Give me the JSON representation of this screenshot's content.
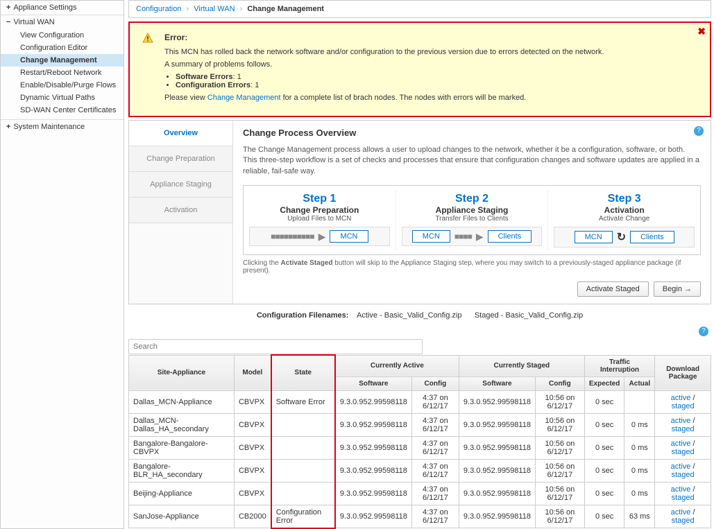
{
  "sidebar": {
    "sections": [
      {
        "label": "Appliance Settings",
        "expanded": false
      },
      {
        "label": "Virtual WAN",
        "expanded": true,
        "items": [
          "View Configuration",
          "Configuration Editor",
          "Change Management",
          "Restart/Reboot Network",
          "Enable/Disable/Purge Flows",
          "Dynamic Virtual Paths",
          "SD-WAN Center Certificates"
        ],
        "active_index": 2
      },
      {
        "label": "System Maintenance",
        "expanded": false
      }
    ]
  },
  "breadcrumb": {
    "crumb1": "Configuration",
    "crumb2": "Virtual WAN",
    "crumb3": "Change Management"
  },
  "error": {
    "heading": "Error:",
    "line1": "This MCN has rolled back the network software and/or configuration to the previous version due to errors detected on the network.",
    "line2": "A summary of problems follows.",
    "bullets": {
      "sw_label": "Software Errors",
      "sw_count": ": 1",
      "cfg_label": "Configuration Errors",
      "cfg_count": ": 1"
    },
    "footer_pre": "Please view ",
    "footer_link": "Change Management",
    "footer_post": " for a complete list of brach nodes. The nodes with errors will be marked."
  },
  "tabs": {
    "overview": "Overview",
    "prep": "Change Preparation",
    "staging": "Appliance Staging",
    "activation": "Activation"
  },
  "main": {
    "title": "Change Process Overview",
    "desc": "The Change Management process allows a user to upload changes to the network, whether it be a configuration, software, or both. This three-step workflow is a set of checks and processes that ensure that configuration changes and software updates are applied in a reliable, fail-safe way.",
    "steps": [
      {
        "num": "Step 1",
        "title": "Change Preparation",
        "sub": "Upload Files to MCN",
        "chips": [
          "MCN"
        ],
        "flow_style": "dots"
      },
      {
        "num": "Step 2",
        "title": "Appliance Staging",
        "sub": "Transfer Files to Clients",
        "chips": [
          "MCN",
          "Clients"
        ],
        "flow_style": "dots"
      },
      {
        "num": "Step 3",
        "title": "Activation",
        "sub": "Activate Change",
        "chips": [
          "MCN",
          "Clients"
        ],
        "flow_style": "refresh"
      }
    ],
    "note_pre": "Clicking the ",
    "note_bold": "Activate Staged",
    "note_post": " button will skip to the Appliance Staging step, where you may switch to a previously-staged appliance package (if present).",
    "btn_activate": "Activate Staged",
    "btn_begin": "Begin →"
  },
  "config_fn": {
    "label": "Configuration Filenames:",
    "active_label": "Active - ",
    "active_val": "Basic_Valid_Config.zip",
    "staged_label": "Staged - ",
    "staged_val": "Basic_Valid_Config.zip"
  },
  "search_placeholder": "Search",
  "table": {
    "headers": {
      "site": "Site-Appliance",
      "model": "Model",
      "state": "State",
      "currently_active": "Currently Active",
      "currently_staged": "Currently Staged",
      "traffic": "Traffic Interruption",
      "download": "Download Package",
      "software": "Software",
      "config": "Config",
      "expected": "Expected",
      "actual": "Actual"
    },
    "rows": [
      {
        "site": "Dallas_MCN-Appliance",
        "model": "CBVPX",
        "state": "Software Error",
        "ca_sw": "9.3.0.952.99598118",
        "ca_cfg": "4:37 on 6/12/17",
        "cs_sw": "9.3.0.952.99598118",
        "cs_cfg": "10:56 on 6/12/17",
        "exp": "0 sec",
        "act": "",
        "dl1": "active",
        "dl2": "staged"
      },
      {
        "site": "Dallas_MCN-Dallas_HA_secondary",
        "model": "CBVPX",
        "state": "",
        "ca_sw": "9.3.0.952.99598118",
        "ca_cfg": "4:37 on 6/12/17",
        "cs_sw": "9.3.0.952.99598118",
        "cs_cfg": "10:56 on 6/12/17",
        "exp": "0 sec",
        "act": "0 ms",
        "dl1": "active",
        "dl2": "staged"
      },
      {
        "site": "Bangalore-Bangalore-CBVPX",
        "model": "CBVPX",
        "state": "",
        "ca_sw": "9.3.0.952.99598118",
        "ca_cfg": "4:37 on 6/12/17",
        "cs_sw": "9.3.0.952.99598118",
        "cs_cfg": "10:56 on 6/12/17",
        "exp": "0 sec",
        "act": "0 ms",
        "dl1": "active",
        "dl2": "staged"
      },
      {
        "site": "Bangalore-BLR_HA_secondary",
        "model": "CBVPX",
        "state": "",
        "ca_sw": "9.3.0.952.99598118",
        "ca_cfg": "4:37 on 6/12/17",
        "cs_sw": "9.3.0.952.99598118",
        "cs_cfg": "10:56 on 6/12/17",
        "exp": "0 sec",
        "act": "0 ms",
        "dl1": "active",
        "dl2": "staged"
      },
      {
        "site": "Beijing-Appliance",
        "model": "CBVPX",
        "state": "",
        "ca_sw": "9.3.0.952.99598118",
        "ca_cfg": "4:37 on 6/12/17",
        "cs_sw": "9.3.0.952.99598118",
        "cs_cfg": "10:56 on 6/12/17",
        "exp": "0 sec",
        "act": "0 ms",
        "dl1": "active",
        "dl2": "staged"
      },
      {
        "site": "SanJose-Appliance",
        "model": "CB2000",
        "state": "Configuration Error",
        "ca_sw": "9.3.0.952.99598118",
        "ca_cfg": "4:37 on 6/12/17",
        "cs_sw": "9.3.0.952.99598118",
        "cs_cfg": "10:56 on 6/12/17",
        "exp": "0 sec",
        "act": "63 ms",
        "dl1": "active",
        "dl2": "staged"
      }
    ]
  }
}
